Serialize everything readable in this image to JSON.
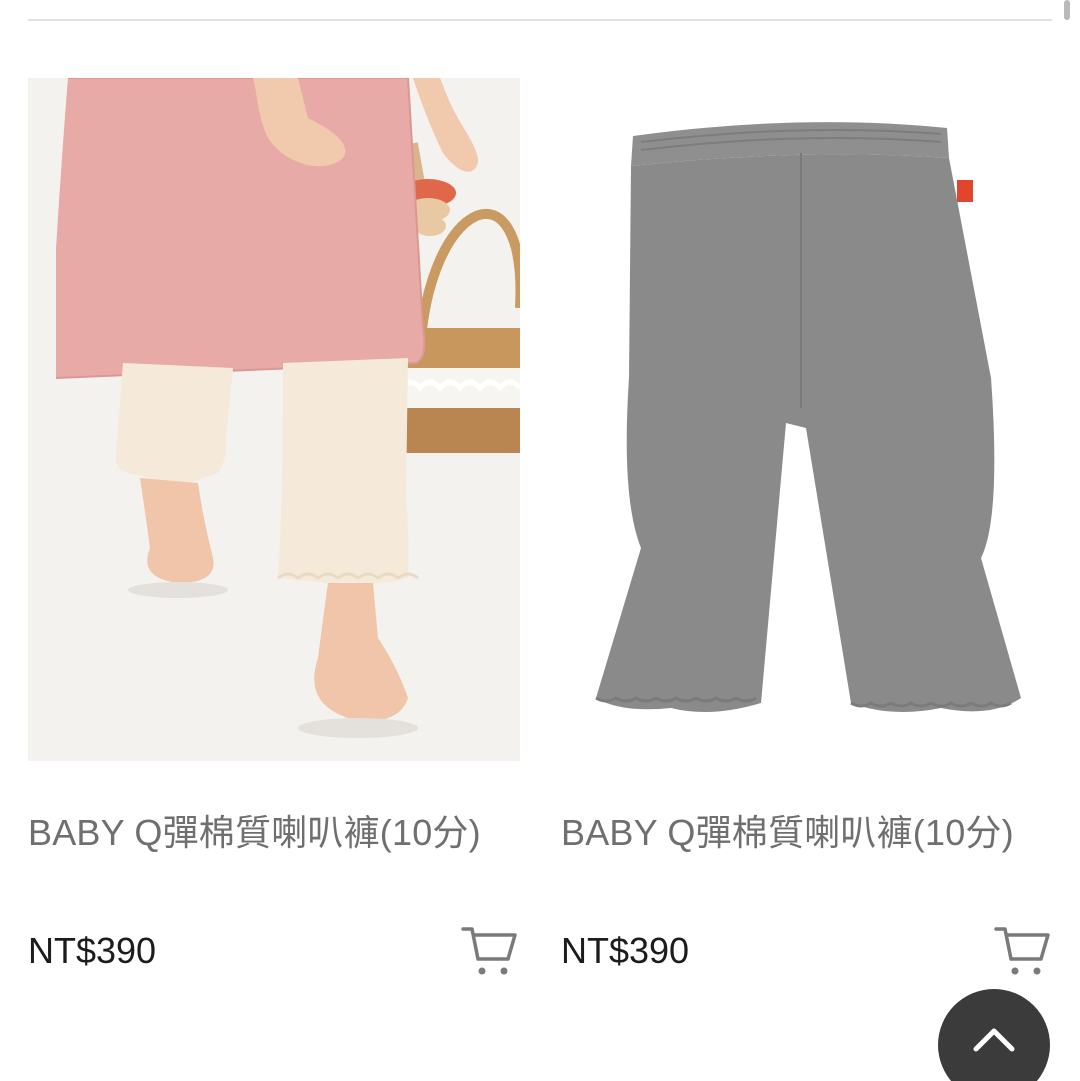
{
  "products": [
    {
      "name": "BABY Q彈棉質喇叭褲(10分)",
      "price": "NT$390",
      "image": "photo of toddler in pink top wearing cream flared pants with basket",
      "cart_icon": "cart-icon"
    },
    {
      "name": "BABY Q彈棉質喇叭褲(10分)",
      "price": "NT$390",
      "image": "grey flared baby pants product shot",
      "cart_icon": "cart-icon"
    }
  ],
  "back_to_top_icon": "chevron-up-icon",
  "colors": {
    "name_text": "#6f6f6f",
    "price_text": "#1c1c1c",
    "cart_icon": "#7a7a7a",
    "back_to_top_bg": "#3b3b3b",
    "pants_grey": "#8a8a8a",
    "pants_cream": "#f5ead9",
    "dress_pink": "#e8aaa6"
  }
}
